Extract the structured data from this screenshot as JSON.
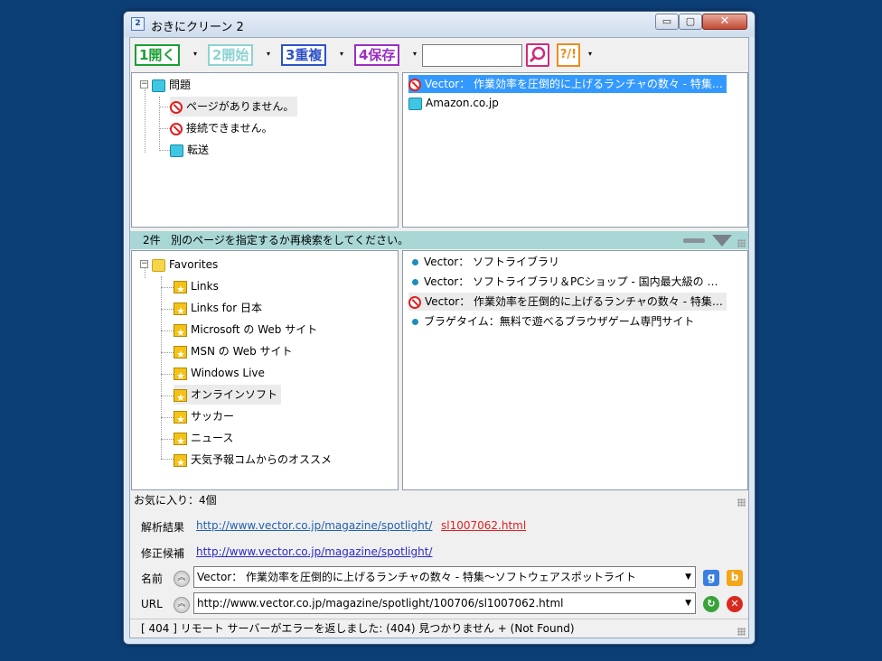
{
  "window": {
    "title": "おきにクリーン 2",
    "min_label": "▭",
    "max_label": "▢",
    "close_label": "✕"
  },
  "toolbar": {
    "btn_open": "1開く",
    "btn_start": "2開始",
    "btn_dup": "3重複",
    "btn_save": "4保存",
    "dropdown_glyph": "▾",
    "search_value": "",
    "help_label": "?/!"
  },
  "problem_tree": {
    "root": "問題",
    "items": [
      "ページがありません。",
      "接続できません。",
      "転送"
    ]
  },
  "problem_results": [
    "Vector： 作業効率を圧倒的に上げるランチャの数々 - 特集…",
    "Amazon.co.jp"
  ],
  "mid_status": {
    "count": "2件",
    "message": "別のページを指定するか再検索をしてください。"
  },
  "favorites_tree": {
    "root": "Favorites",
    "items": [
      "Links",
      "Links for 日本",
      "Microsoft の Web サイト",
      "MSN の Web サイト",
      "Windows Live",
      "オンラインソフト",
      "サッカー",
      "ニュース",
      "天気予報コムからのオススメ"
    ]
  },
  "favorites_results": [
    "Vector： ソフトライブラリ",
    "Vector： ソフトライブラリ＆PCショップ - 国内最大級の …",
    "Vector： 作業効率を圧倒的に上げるランチャの数々 - 特集…",
    "ブラゲタイム：無料で遊べるブラウザゲーム専門サイト"
  ],
  "fav_count": "お気に入り：4個",
  "details": {
    "analysis_label": "解析結果",
    "analysis_link1": "http://www.vector.co.jp/magazine/spotlight/",
    "analysis_link2": "sl1007062.html",
    "fix_label": "修正候補",
    "fix_link": "http://www.vector.co.jp/magazine/spotlight/",
    "name_label": "名前",
    "name_value": "Vector： 作業効率を圧倒的に上げるランチャの数々 - 特集～ソフトウェアスポットライト",
    "url_label": "URL",
    "url_value": "http://www.vector.co.jp/magazine/spotlight/100706/sl1007062.html",
    "google_glyph": "g",
    "bing_glyph": "b",
    "go_glyph": "↻",
    "delete_glyph": "✕",
    "chevron_glyph": "︽",
    "combo_arrow": "▼"
  },
  "status_message": "[ 404 ] リモート サーバーがエラーを返しました: (404) 見つかりません + (Not Found)",
  "colors": {
    "link": "#2060b0",
    "error": "#e02020",
    "selected": "#3399ff",
    "status_bar": "#a8d7d6"
  }
}
